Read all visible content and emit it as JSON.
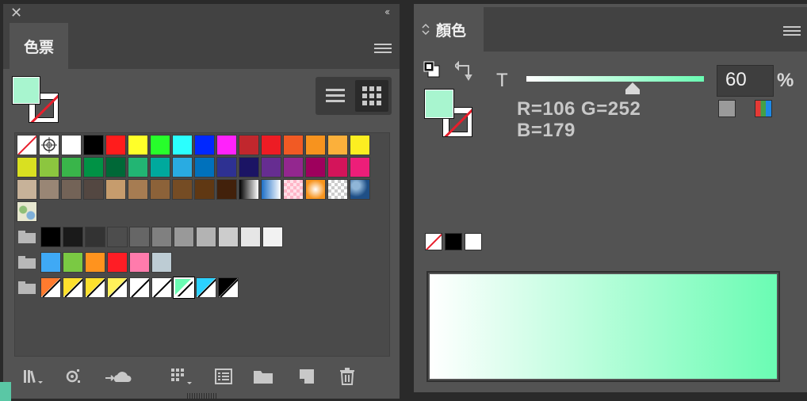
{
  "swatches_panel": {
    "tab_label": "色票",
    "fill_color": "#a8f5cf",
    "rows": [
      [
        "none",
        "registration",
        "#ffffff",
        "#000000",
        "#ff1c1c",
        "#ffff29",
        "#27fe2b",
        "#2bfffe",
        "#0028ff",
        "#ff22fb",
        "#c1272d",
        "#ed1c24",
        "#f15a24",
        "#f7931e",
        "#fbb03b",
        "#fcee21"
      ],
      [
        "#d9e021",
        "#8cc63f",
        "#39b54a",
        "#009245",
        "#006837",
        "#22b573",
        "#00a99d",
        "#29abe2",
        "#0071bc",
        "#2e3192",
        "#1b1464",
        "#662d91",
        "#93278f",
        "#9e005d",
        "#d4145a",
        "#ed1e79"
      ],
      [
        "#c7b299",
        "#998675",
        "#736357",
        "#534741",
        "#c69c6d",
        "#a67c52",
        "#8c6239",
        "#754c24",
        "#603813",
        "#42210b",
        "grad-bw",
        "grad-blue",
        "pat-check",
        "grad-rad",
        "pat-trans",
        "pat-blue"
      ],
      [
        "pat-dots"
      ]
    ],
    "group_grays": [
      "#000000",
      "#1a1a1a",
      "#333333",
      "#4d4d4d",
      "#666666",
      "#808080",
      "#999999",
      "#b3b3b3",
      "#cccccc",
      "#e6e6e6",
      "#f2f2f2"
    ],
    "group_brights": [
      "#3fa9f5",
      "#7ac943",
      "#ff931e",
      "#ff1d25",
      "#ff7bac",
      "#bdccd4"
    ],
    "group_spots": [
      "#ff7b2e",
      "#fde02d",
      "#fde02d",
      "#fff15a",
      "#ffffff",
      "#ffffff",
      "#6afcb3",
      "#2bd1ff",
      "#000000"
    ],
    "icons": [
      "library-icon",
      "swatch-kinds-icon",
      "cloud-sync-icon",
      "swatch-options-icon",
      "list-icon",
      "folder-icon",
      "new-swatch-icon",
      "trash-icon"
    ]
  },
  "color_panel": {
    "tab_label": "顏色",
    "tab_arrows": "◇",
    "slider_label": "T",
    "tint_percent": 60,
    "percent_value": "60",
    "percent_symbol": "%",
    "readout_line1": "R=106 G=252",
    "readout_line2": "B=179",
    "fill_color": "#a8f5cf",
    "base_color": "#6afcb3",
    "mini_swatches": [
      "none",
      "#000000",
      "#ffffff"
    ]
  },
  "window": {
    "close_glyph": "✕",
    "collapse_glyph": "‹‹"
  }
}
